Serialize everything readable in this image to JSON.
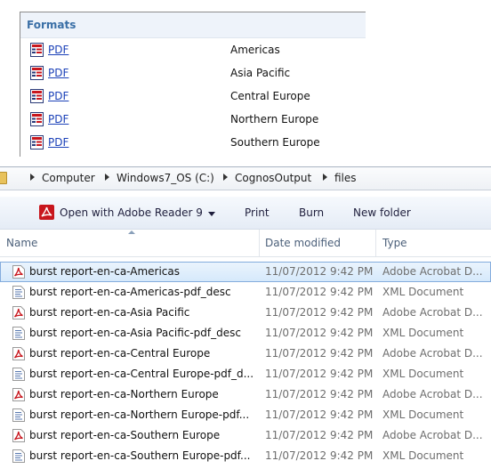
{
  "formats_panel": {
    "header": "Formats",
    "rows": [
      {
        "icon": "pdf-report-icon",
        "link": "PDF",
        "region": "Americas"
      },
      {
        "icon": "pdf-report-icon",
        "link": "PDF",
        "region": "Asia Pacific"
      },
      {
        "icon": "pdf-report-icon",
        "link": "PDF",
        "region": "Central Europe"
      },
      {
        "icon": "pdf-report-icon",
        "link": "PDF",
        "region": "Northern Europe"
      },
      {
        "icon": "pdf-report-icon",
        "link": "PDF",
        "region": "Southern Europe"
      }
    ]
  },
  "explorer": {
    "breadcrumb": [
      "Computer",
      "Windows7_OS (C:)",
      "CognosOutput",
      "files"
    ],
    "toolbar": {
      "open_with": "Open with Adobe Reader 9",
      "print": "Print",
      "burn": "Burn",
      "new_folder": "New folder"
    },
    "columns": {
      "name": "Name",
      "date": "Date modified",
      "type": "Type"
    },
    "files": [
      {
        "name": "burst report-en-ca-Americas",
        "date": "11/07/2012 9:42 PM",
        "type": "Adobe Acrobat D...",
        "icon": "pdf-file-icon",
        "selected": true
      },
      {
        "name": "burst report-en-ca-Americas-pdf_desc",
        "date": "11/07/2012 9:42 PM",
        "type": "XML Document",
        "icon": "xml-file-icon"
      },
      {
        "name": "burst report-en-ca-Asia Pacific",
        "date": "11/07/2012 9:42 PM",
        "type": "Adobe Acrobat D...",
        "icon": "pdf-file-icon"
      },
      {
        "name": "burst report-en-ca-Asia Pacific-pdf_desc",
        "date": "11/07/2012 9:42 PM",
        "type": "XML Document",
        "icon": "xml-file-icon"
      },
      {
        "name": "burst report-en-ca-Central Europe",
        "date": "11/07/2012 9:42 PM",
        "type": "Adobe Acrobat D...",
        "icon": "pdf-file-icon"
      },
      {
        "name": "burst report-en-ca-Central Europe-pdf_d...",
        "date": "11/07/2012 9:42 PM",
        "type": "XML Document",
        "icon": "xml-file-icon"
      },
      {
        "name": "burst report-en-ca-Northern Europe",
        "date": "11/07/2012 9:42 PM",
        "type": "Adobe Acrobat D...",
        "icon": "pdf-file-icon"
      },
      {
        "name": "burst report-en-ca-Northern Europe-pdf...",
        "date": "11/07/2012 9:42 PM",
        "type": "XML Document",
        "icon": "xml-file-icon"
      },
      {
        "name": "burst report-en-ca-Southern Europe",
        "date": "11/07/2012 9:42 PM",
        "type": "Adobe Acrobat D...",
        "icon": "pdf-file-icon"
      },
      {
        "name": "burst report-en-ca-Southern Europe-pdf...",
        "date": "11/07/2012 9:42 PM",
        "type": "XML Document",
        "icon": "xml-file-icon"
      }
    ]
  },
  "colors": {
    "link": "#1b41b8",
    "header_text": "#3a6fa6",
    "selection_border": "#84acdd",
    "pdf_red": "#c8161d"
  }
}
